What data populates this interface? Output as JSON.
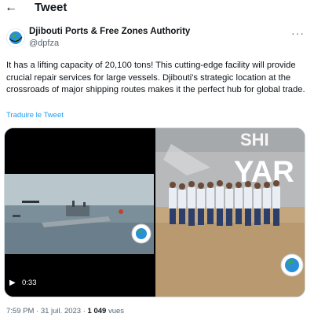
{
  "header": {
    "back_icon": "arrow-left-icon",
    "title": "Tweet"
  },
  "author": {
    "name": "Djibouti Ports & Free Zones Authority",
    "handle": "@dpfza",
    "more_icon": "more-horizontal-icon"
  },
  "tweet": {
    "text": "It has a lifting capacity of 20,100 tons! This cutting-edge facility will provide crucial repair services for large vessels. Djibouti's strategic location at the crossroads of major shipping routes makes it the perfect hub for global trade.",
    "translate_label": "Traduire le Tweet"
  },
  "media": {
    "video": {
      "play_icon": "play-icon",
      "duration": "0:33"
    },
    "photo": {
      "sign_text": "YAR",
      "sign_text_top": "SHI"
    }
  },
  "meta": {
    "time": "7:59 PM",
    "separator": " · ",
    "date": "31 juil. 2023",
    "views_count": "1 049",
    "views_label": "vues"
  },
  "colors": {
    "accent": "#1d9bf0",
    "secondary_text": "#536471",
    "sea": "#7b8f9a",
    "sky": "#b9c6cc"
  }
}
